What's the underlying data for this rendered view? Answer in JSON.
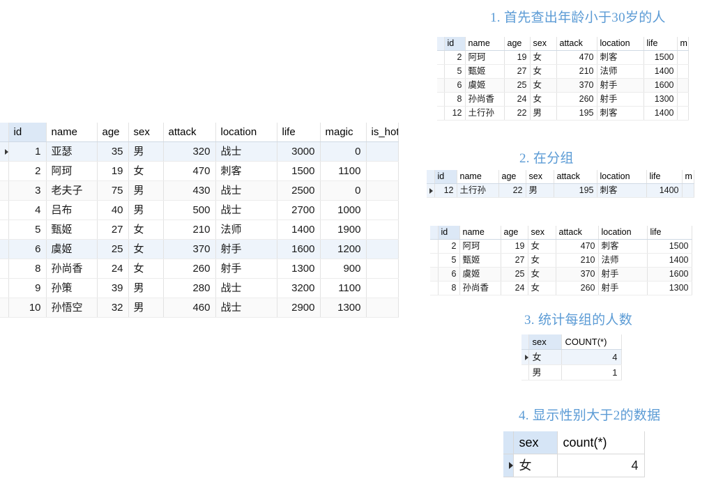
{
  "sections": {
    "q1_title": "1. 首先查出年龄小于30岁的人",
    "q2_title": "2. 在分组",
    "q3_title": "3. 统计每组的人数",
    "q4_title": "4. 显示性别大于2的数据"
  },
  "main_table": {
    "columns": [
      "id",
      "name",
      "age",
      "sex",
      "attack",
      "location",
      "life",
      "magic",
      "is_hot"
    ],
    "rows": [
      {
        "id": "1",
        "name": "亚瑟",
        "age": "35",
        "sex": "男",
        "attack": "320",
        "location": "战士",
        "life": "3000",
        "magic": "0",
        "is_hot": "",
        "selected": true,
        "alt": false
      },
      {
        "id": "2",
        "name": "阿珂",
        "age": "19",
        "sex": "女",
        "attack": "470",
        "location": "刺客",
        "life": "1500",
        "magic": "1100",
        "is_hot": "",
        "selected": false,
        "alt": false
      },
      {
        "id": "3",
        "name": "老夫子",
        "age": "75",
        "sex": "男",
        "attack": "430",
        "location": "战士",
        "life": "2500",
        "magic": "0",
        "is_hot": "",
        "selected": false,
        "alt": true
      },
      {
        "id": "4",
        "name": "吕布",
        "age": "40",
        "sex": "男",
        "attack": "500",
        "location": "战士",
        "life": "2700",
        "magic": "1000",
        "is_hot": "",
        "selected": false,
        "alt": false
      },
      {
        "id": "5",
        "name": "甄姬",
        "age": "27",
        "sex": "女",
        "attack": "210",
        "location": "法师",
        "life": "1400",
        "magic": "1900",
        "is_hot": "",
        "selected": false,
        "alt": false
      },
      {
        "id": "6",
        "name": "虞姬",
        "age": "25",
        "sex": "女",
        "attack": "370",
        "location": "射手",
        "life": "1600",
        "magic": "1200",
        "is_hot": "",
        "selected": false,
        "alt": false,
        "hl": true
      },
      {
        "id": "8",
        "name": "孙尚香",
        "age": "24",
        "sex": "女",
        "attack": "260",
        "location": "射手",
        "life": "1300",
        "magic": "900",
        "is_hot": "",
        "selected": false,
        "alt": false
      },
      {
        "id": "9",
        "name": "孙策",
        "age": "39",
        "sex": "男",
        "attack": "280",
        "location": "战士",
        "life": "3200",
        "magic": "1100",
        "is_hot": "",
        "selected": false,
        "alt": false
      },
      {
        "id": "10",
        "name": "孙悟空",
        "age": "32",
        "sex": "男",
        "attack": "460",
        "location": "战士",
        "life": "2900",
        "magic": "1300",
        "is_hot": "",
        "selected": false,
        "alt": true
      }
    ]
  },
  "q1_table": {
    "columns": [
      "id",
      "name",
      "age",
      "sex",
      "attack",
      "location",
      "life",
      "m"
    ],
    "rows": [
      {
        "id": "2",
        "name": "阿珂",
        "age": "19",
        "sex": "女",
        "attack": "470",
        "location": "刺客",
        "life": "1500",
        "m": "",
        "alt": false
      },
      {
        "id": "5",
        "name": "甄姬",
        "age": "27",
        "sex": "女",
        "attack": "210",
        "location": "法师",
        "life": "1400",
        "m": "",
        "alt": false
      },
      {
        "id": "6",
        "name": "虞姬",
        "age": "25",
        "sex": "女",
        "attack": "370",
        "location": "射手",
        "life": "1600",
        "m": "",
        "alt": true
      },
      {
        "id": "8",
        "name": "孙尚香",
        "age": "24",
        "sex": "女",
        "attack": "260",
        "location": "射手",
        "life": "1300",
        "m": "",
        "alt": false
      },
      {
        "id": "12",
        "name": "土行孙",
        "age": "22",
        "sex": "男",
        "attack": "195",
        "location": "刺客",
        "life": "1400",
        "m": "",
        "alt": false
      }
    ]
  },
  "q2_table": {
    "columns": [
      "id",
      "name",
      "age",
      "sex",
      "attack",
      "location",
      "life",
      "m"
    ],
    "rows": [
      {
        "id": "12",
        "name": "土行孙",
        "age": "22",
        "sex": "男",
        "attack": "195",
        "location": "刺客",
        "life": "1400",
        "m": "",
        "selected": true,
        "alt": false
      }
    ]
  },
  "q3_table": {
    "columns": [
      "id",
      "name",
      "age",
      "sex",
      "attack",
      "location",
      "life"
    ],
    "rows": [
      {
        "id": "2",
        "name": "阿珂",
        "age": "19",
        "sex": "女",
        "attack": "470",
        "location": "刺客",
        "life": "1500",
        "alt": false
      },
      {
        "id": "5",
        "name": "甄姬",
        "age": "27",
        "sex": "女",
        "attack": "210",
        "location": "法师",
        "life": "1400",
        "alt": false
      },
      {
        "id": "6",
        "name": "虞姬",
        "age": "25",
        "sex": "女",
        "attack": "370",
        "location": "射手",
        "life": "1600",
        "alt": true
      },
      {
        "id": "8",
        "name": "孙尚香",
        "age": "24",
        "sex": "女",
        "attack": "260",
        "location": "射手",
        "life": "1300",
        "alt": false
      }
    ]
  },
  "count_table": {
    "columns": [
      "sex",
      "COUNT(*)"
    ],
    "rows": [
      {
        "sex": "女",
        "count": "4",
        "selected": true
      },
      {
        "sex": "男",
        "count": "1",
        "selected": false
      }
    ]
  },
  "final_table": {
    "columns": [
      "sex",
      "count(*)"
    ],
    "rows": [
      {
        "sex": "女",
        "count": "4",
        "selected": true
      }
    ]
  },
  "colors": {
    "title": "#5b9bd5",
    "header_bg": "#e8f0fa",
    "id_header_bg": "#dce8f6",
    "selected_row": "#eef4fb"
  }
}
